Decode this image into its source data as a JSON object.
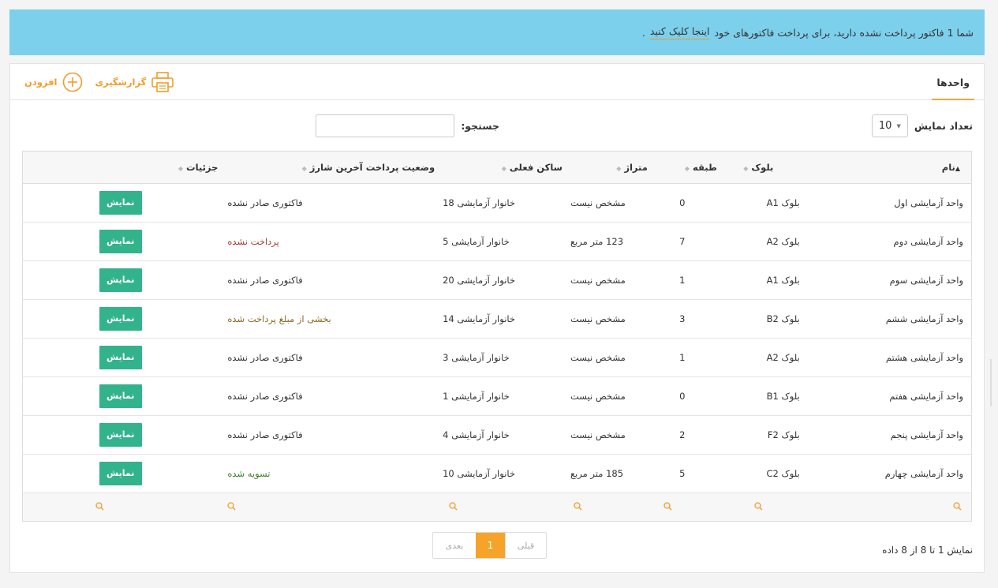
{
  "alert": {
    "text": "شما 1 فاکتور پرداخت نشده دارید، برای پرداخت فاکتورهای خود",
    "link": "اینجا کلیک کنید",
    "tail": "."
  },
  "panel": {
    "title": "واحدها",
    "report_label": "گزارشگیری",
    "add_label": "افزودن"
  },
  "controls": {
    "length_label": "تعداد نمایش",
    "length_value": "10",
    "search_label": "جستجو:",
    "search_value": ""
  },
  "table": {
    "headers": [
      "نام",
      "بلوک",
      "طبقه",
      "متراژ",
      "ساکن فعلی",
      "وضعیت پرداخت آخرین شارژ",
      "جزئیات"
    ],
    "rows": [
      [
        "واحد آزمایشی اول",
        "بلوک A1",
        "0",
        "مشخص نیست",
        "خانوار آزمایشی 18",
        "فاکتوری صادر نشده",
        "نمایش"
      ],
      [
        "واحد آزمایشی دوم",
        "بلوک A2",
        "7",
        "123 متر مربع",
        "خانوار آزمایشی 5",
        "پرداخت نشده",
        "نمایش"
      ],
      [
        "واحد آزمایشی سوم",
        "بلوک A1",
        "1",
        "مشخص نیست",
        "خانوار آزمایشی 20",
        "فاکتوری صادر نشده",
        "نمایش"
      ],
      [
        "واحد آزمایشی ششم",
        "بلوک B2",
        "3",
        "مشخص نیست",
        "خانوار آزمایشی 14",
        "بخشی از مبلغ پرداخت شده",
        "نمایش"
      ],
      [
        "واحد آزمایشی هشتم",
        "بلوک A2",
        "1",
        "مشخص نیست",
        "خانوار آزمایشی 3",
        "فاکتوری صادر نشده",
        "نمایش"
      ],
      [
        "واحد آزمایشی هفتم",
        "بلوک B1",
        "0",
        "مشخص نیست",
        "خانوار آزمایشی 1",
        "فاکتوری صادر نشده",
        "نمایش"
      ],
      [
        "واحد آزمایشی پنجم",
        "بلوک F2",
        "2",
        "مشخص نیست",
        "خانوار آزمایشی 4",
        "فاکتوری صادر نشده",
        "نمایش"
      ],
      [
        "واحد آزمایشی چهارم",
        "بلوک C2",
        "5",
        "185 متر مربع",
        "خانوار آزمایشی 10",
        "تسویه شده",
        "نمایش"
      ]
    ],
    "status_colors": {
      "پرداخت نشده": "#a33a2c",
      "بخشی از مبلغ پرداخت شده": "#8a6a22",
      "تسویه شده": "#3f7f2f"
    }
  },
  "footer": {
    "info": "نمایش 1 تا 8 از 8 داده",
    "prev": "قبلی",
    "page": "1",
    "next": "بعدی"
  },
  "colors": {
    "accent": "#f39c2c",
    "alert_bg": "#7dd0ec",
    "show_button": "#33b38c"
  }
}
